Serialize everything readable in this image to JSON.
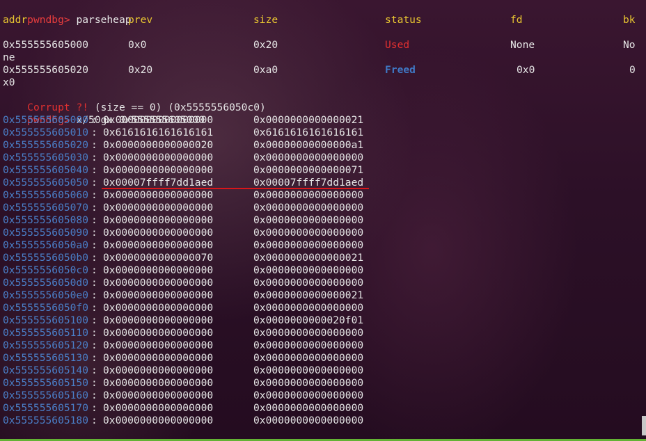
{
  "prompt": "pwndbg>",
  "commands": {
    "first": "parseheap",
    "second": "x/50gx 0x555555605000"
  },
  "parseheap": {
    "headers": [
      "addr",
      "prev",
      "size",
      "status",
      "fd",
      "bk"
    ],
    "rows": [
      {
        "addr": "0x555555605000",
        "prev": "0x0",
        "size": "0x20",
        "status": "Used",
        "fd": "None",
        "bk": "No",
        "wrap": "ne"
      },
      {
        "addr": "0x555555605020",
        "prev": "0x20",
        "size": "0xa0",
        "status": "Freed",
        "fd": "0x0",
        "bk": "0",
        "wrap": "x0"
      }
    ],
    "corrupt_label": "Corrupt ?!",
    "corrupt_detail": " (size == 0) (0x5555556050c0)"
  },
  "memory": [
    {
      "addr": "0x555555605000",
      "v1": "0x0000000000000000",
      "v2": "0x0000000000000021"
    },
    {
      "addr": "0x555555605010",
      "v1": "0x6161616161616161",
      "v2": "0x6161616161616161"
    },
    {
      "addr": "0x555555605020",
      "v1": "0x0000000000000020",
      "v2": "0x00000000000000a1"
    },
    {
      "addr": "0x555555605030",
      "v1": "0x0000000000000000",
      "v2": "0x0000000000000000"
    },
    {
      "addr": "0x555555605040",
      "v1": "0x0000000000000000",
      "v2": "0x0000000000000071"
    },
    {
      "addr": "0x555555605050",
      "v1": "0x00007ffff7dd1aed",
      "v2": "0x00007ffff7dd1aed"
    },
    {
      "addr": "0x555555605060",
      "v1": "0x0000000000000000",
      "v2": "0x0000000000000000"
    },
    {
      "addr": "0x555555605070",
      "v1": "0x0000000000000000",
      "v2": "0x0000000000000000"
    },
    {
      "addr": "0x555555605080",
      "v1": "0x0000000000000000",
      "v2": "0x0000000000000000"
    },
    {
      "addr": "0x555555605090",
      "v1": "0x0000000000000000",
      "v2": "0x0000000000000000"
    },
    {
      "addr": "0x5555556050a0",
      "v1": "0x0000000000000000",
      "v2": "0x0000000000000000"
    },
    {
      "addr": "0x5555556050b0",
      "v1": "0x0000000000000070",
      "v2": "0x0000000000000021"
    },
    {
      "addr": "0x5555556050c0",
      "v1": "0x0000000000000000",
      "v2": "0x0000000000000000"
    },
    {
      "addr": "0x5555556050d0",
      "v1": "0x0000000000000000",
      "v2": "0x0000000000000000"
    },
    {
      "addr": "0x5555556050e0",
      "v1": "0x0000000000000000",
      "v2": "0x0000000000000021"
    },
    {
      "addr": "0x5555556050f0",
      "v1": "0x0000000000000000",
      "v2": "0x0000000000000000"
    },
    {
      "addr": "0x555555605100",
      "v1": "0x0000000000000000",
      "v2": "0x0000000000020f01"
    },
    {
      "addr": "0x555555605110",
      "v1": "0x0000000000000000",
      "v2": "0x0000000000000000"
    },
    {
      "addr": "0x555555605120",
      "v1": "0x0000000000000000",
      "v2": "0x0000000000000000"
    },
    {
      "addr": "0x555555605130",
      "v1": "0x0000000000000000",
      "v2": "0x0000000000000000"
    },
    {
      "addr": "0x555555605140",
      "v1": "0x0000000000000000",
      "v2": "0x0000000000000000"
    },
    {
      "addr": "0x555555605150",
      "v1": "0x0000000000000000",
      "v2": "0x0000000000000000"
    },
    {
      "addr": "0x555555605160",
      "v1": "0x0000000000000000",
      "v2": "0x0000000000000000"
    },
    {
      "addr": "0x555555605170",
      "v1": "0x0000000000000000",
      "v2": "0x0000000000000000"
    },
    {
      "addr": "0x555555605180",
      "v1": "0x0000000000000000",
      "v2": "0x0000000000000000"
    }
  ],
  "highlighted_row": "0x555555605050",
  "colors": {
    "prompt": "#e83d3d",
    "header": "#e8c531",
    "used": "#e03030",
    "freed": "#3f79c6",
    "address": "#4a7fc8",
    "underline": "#d9161a"
  }
}
